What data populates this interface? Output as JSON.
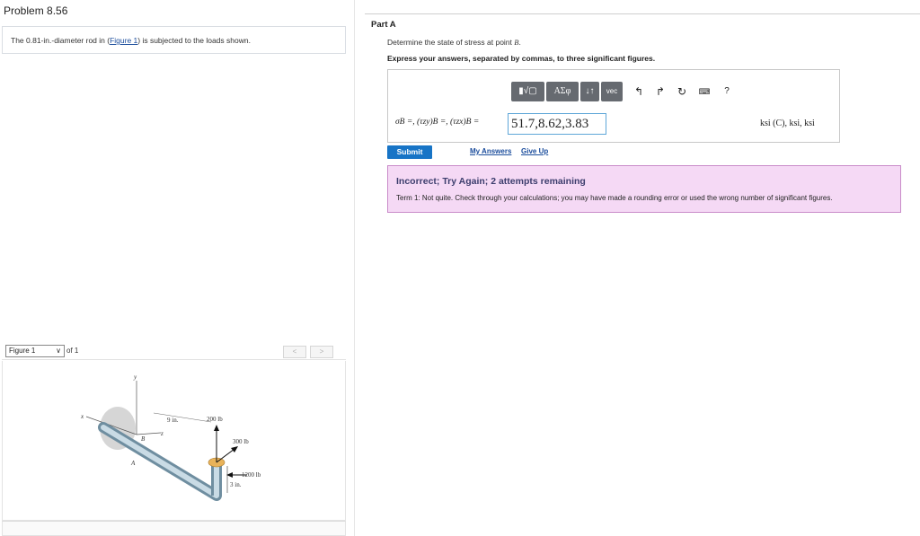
{
  "problem": {
    "title": "Problem 8.56",
    "text_prefix": "The 0.81-in.-diameter rod in (",
    "figure_link": "Figure 1",
    "text_suffix": ") is subjected to the loads shown."
  },
  "figure": {
    "select_value": "Figure 1",
    "of_label": "of 1",
    "prev_glyph": "<",
    "next_glyph": ">",
    "labels": {
      "y": "y",
      "x": "x",
      "z": "z",
      "B": "B",
      "A": "A",
      "dim_9in": "9 in.",
      "load_200": "200 lb",
      "load_300": "300 lb",
      "load_1200": "1200 lb",
      "dim_3in": "3 in."
    }
  },
  "part": {
    "label": "Part A",
    "question_prefix": "Determine the state of stress at point ",
    "question_point": "B",
    "question_suffix": ".",
    "instruction": "Express your answers, separated by commas, to three significant figures."
  },
  "toolbar": {
    "templates": "▮√▢",
    "greek": "ΑΣφ",
    "arrows": "↓↑",
    "vec": "vec",
    "undo": "↰",
    "redo": "↱",
    "reset": "↻",
    "keyboard": "⌨",
    "help": "?"
  },
  "answer": {
    "math_label": "σB =, (τzy)B =, (τzx)B =",
    "value": "51.7,8.62,3.83",
    "units": "ksi (C), ksi, ksi"
  },
  "actions": {
    "submit": "Submit",
    "my_answers": "My Answers",
    "give_up": "Give Up"
  },
  "feedback": {
    "title": "Incorrect; Try Again; 2 attempts remaining",
    "text": "Term 1: Not quite. Check through your calculations; you may have made a rounding error or used the wrong number of significant figures."
  },
  "colors": {
    "submit_bg": "#1774c6",
    "link": "#1a4c9c",
    "feedback_bg": "#f5d9f5",
    "feedback_border": "#c98cc9",
    "input_border": "#5fa7d8",
    "toolbar_bg": "#666a70"
  }
}
